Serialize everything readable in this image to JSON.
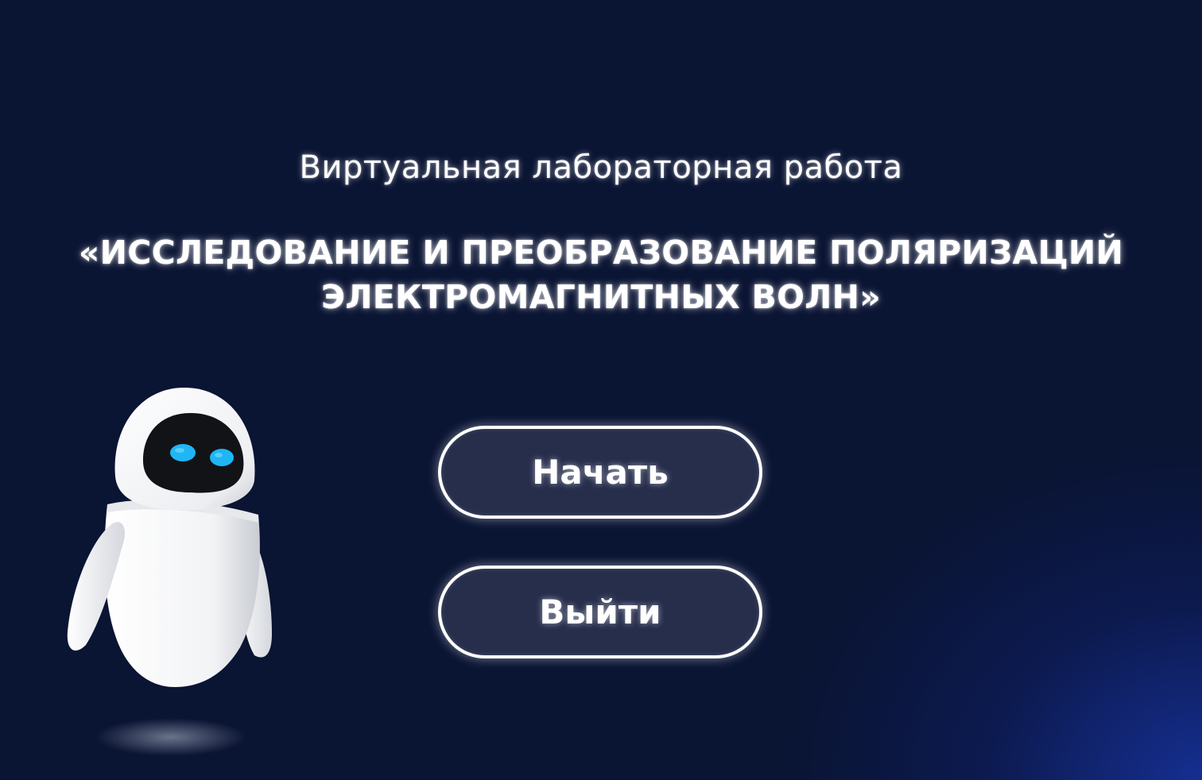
{
  "header": {
    "subtitle": "Виртуальная лабораторная работа",
    "title_line1": "«ИССЛЕДОВАНИЕ И ПРЕОБРАЗОВАНИЕ ПОЛЯРИЗАЦИЙ",
    "title_line2": "ЭЛЕКТРОМАГНИТНЫХ ВОЛН»"
  },
  "menu": {
    "start_label": "Начать",
    "exit_label": "Выйти"
  },
  "mascot": {
    "icon": "robot-mascot-icon",
    "eye_color": "#1fb6f5",
    "body_color": "#ffffff"
  },
  "colors": {
    "background": "#0a1433",
    "button_fill": "#262e4c",
    "button_border": "#ffffff",
    "text": "#ffffff"
  }
}
